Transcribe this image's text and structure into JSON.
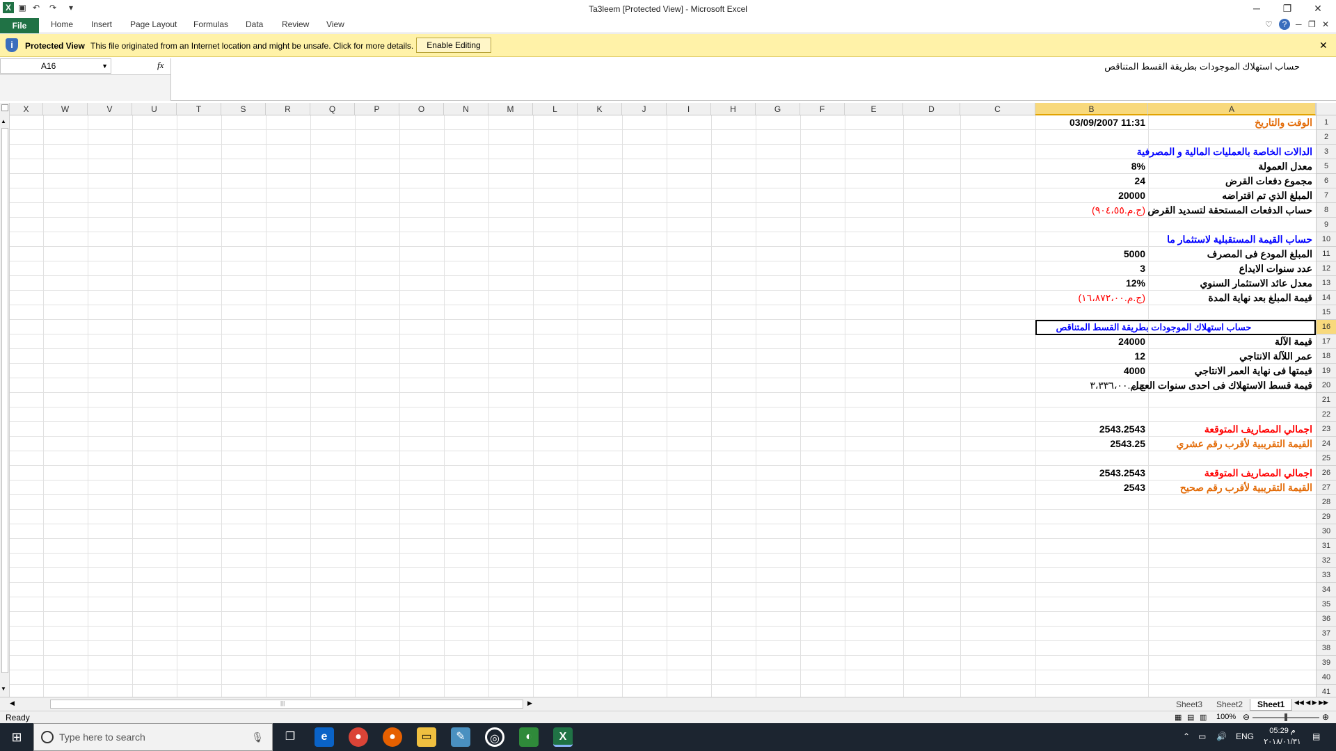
{
  "window": {
    "title": "Ta3leem  [Protected View] - Microsoft Excel",
    "minimize": "─",
    "restore": "❐",
    "close": "✕"
  },
  "ribbon": {
    "tabs": [
      "File",
      "Home",
      "Insert",
      "Page Layout",
      "Formulas",
      "Data",
      "Review",
      "View"
    ]
  },
  "protected_view": {
    "title": "Protected View",
    "message": "This file originated from an Internet location and might be unsafe. Click for more details.",
    "button": "Enable Editing",
    "close": "✕"
  },
  "formula_bar": {
    "name_box": "A16",
    "fx": "fx",
    "formula": "حساب استهلاك الموجودات بطريقة القسط المتناقص"
  },
  "columns": [
    "X",
    "W",
    "V",
    "U",
    "T",
    "S",
    "R",
    "Q",
    "P",
    "O",
    "N",
    "M",
    "L",
    "K",
    "J",
    "I",
    "H",
    "G",
    "F",
    "E",
    "D",
    "C",
    "B",
    "A"
  ],
  "rows": [
    "1",
    "2",
    "3",
    "5",
    "6",
    "7",
    "8",
    "9",
    "10",
    "11",
    "12",
    "13",
    "14",
    "15",
    "16",
    "17",
    "18",
    "19",
    "20",
    "21",
    "22",
    "23",
    "24",
    "25",
    "26",
    "27",
    "28",
    "29",
    "30",
    "31",
    "32",
    "33",
    "34",
    "35",
    "36",
    "37",
    "38",
    "39",
    "40",
    "41"
  ],
  "cells": {
    "r1": {
      "a": "الوقت والتاريخ",
      "b": "03/09/2007 11:31"
    },
    "r3": {
      "a": "الدالات الخاصة بالعمليات المالية و المصرفية",
      "b": ""
    },
    "r5": {
      "a": "معدل العمولة",
      "b": "8%"
    },
    "r6": {
      "a": "مجموع دفعات القرض",
      "b": "24"
    },
    "r7": {
      "a": "المبلغ الذي تم اقتراضه",
      "b": "20000"
    },
    "r8": {
      "a": "حساب الدفعات المستحقة لتسديد القرض",
      "b": "(ج.م.‏٩٠٤،٥٥)"
    },
    "r10": {
      "a": "حساب القيمة المستقبلية لاستثمار ما",
      "b": ""
    },
    "r11": {
      "a": "المبلغ المودع فى المصرف",
      "b": "5000"
    },
    "r12": {
      "a": "عدد سنوات الايداع",
      "b": "3"
    },
    "r13": {
      "a": "معدل عائد الاستثمار السنوي",
      "b": "12%"
    },
    "r14": {
      "a": "قيمة المبلغ بعد نهاية المدة",
      "b": "(ج.م.‏١٦،٨٧٢،٠٠)"
    },
    "r16": {
      "a": "حساب استهلاك الموجودات بطريقة القسط المتناقص",
      "b": ""
    },
    "r17": {
      "a": "قيمة الآلة",
      "b": "24000"
    },
    "r18": {
      "a": "عمر اللآلة الانتاجي",
      "b": "12"
    },
    "r19": {
      "a": "قيمتها فى نهاية العمر الانتاجي",
      "b": "4000"
    },
    "r20": {
      "a": "قيمة قسط الاستهلاك فى احدى سنوات العمل",
      "b": "ج.م.‏٣،٣٣٦،٠٠"
    },
    "r23": {
      "a": "اجمالي المصاريف المتوقعة",
      "b": "2543.2543"
    },
    "r24": {
      "a": "القيمة التقريبية لأقرب رقم عشري",
      "b": "2543.25"
    },
    "r26": {
      "a": "اجمالي المصاريف المتوقعة",
      "b": "2543.2543"
    },
    "r27": {
      "a": "القيمة التقريبية لأقرب رقم صحيح",
      "b": "2543"
    }
  },
  "sheets": [
    "Sheet3",
    "Sheet2",
    "Sheet1"
  ],
  "active_sheet": "Sheet1",
  "status": {
    "ready": "Ready",
    "zoom": "100%"
  },
  "taskbar": {
    "search_placeholder": "Type here to search",
    "language": "ENG",
    "time": "05:29 م",
    "date": "٢٠١٨/٠١/٣١"
  },
  "colors": {
    "excel_green": "#207245",
    "orange": "#e36c09",
    "blue": "#0000ff",
    "red": "#ff0000",
    "pv_yellow": "#fff2a8"
  }
}
